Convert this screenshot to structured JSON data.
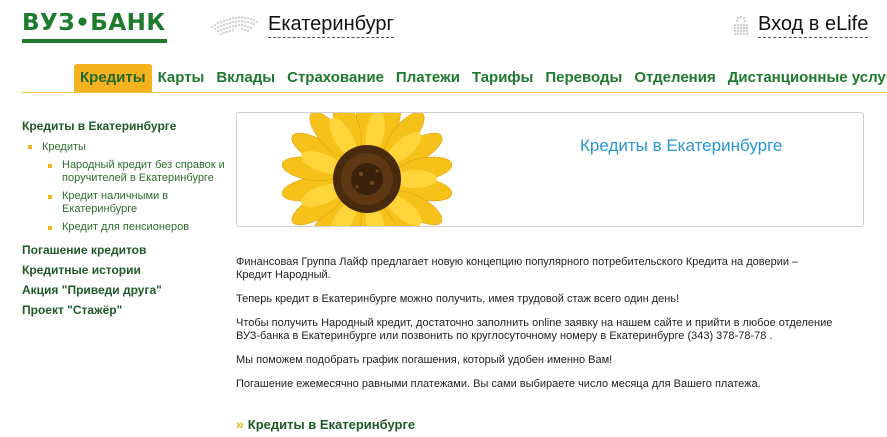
{
  "header": {
    "logo_text": "ВУЗ•БАНК",
    "city": "Екатеринбург",
    "login": "Вход в eLife"
  },
  "nav": {
    "items": [
      "Кредиты",
      "Карты",
      "Вклады",
      "Страхование",
      "Платежи",
      "Тарифы",
      "Переводы",
      "Отделения",
      "Дистанционные услуги"
    ],
    "active": "Кредиты"
  },
  "sidebar": {
    "heading": "Кредиты в Екатеринбурге",
    "level1": "Кредиты",
    "level2": [
      "Народный кредит без справок и поручителей в Екатеринбурге",
      "Кредит наличными в Екатеринбурге",
      "Кредит для пенсионеров"
    ],
    "links": [
      "Погашение кредитов",
      "Кредитные истории",
      "Акция \"Приведи друга\"",
      "Проект \"Стажёр\""
    ]
  },
  "banner": {
    "title": "Кредиты в Екатеринбурге"
  },
  "content": {
    "paragraphs": [
      "Финансовая Группа Лайф предлагает новую концепцию популярного потребительского Кредита на доверии – Кредит Народный.",
      "Теперь кредит в Екатеринбурге можно получить, имея трудовой стаж всего один день!",
      "Чтобы получить Народный кредит, достаточно заполнить online заявку на нашем сайте и прийти в любое отделение ВУЗ-банка в Екатеринбурге или позвонить по круглосуточному номеру в Екатеринбурге (343) 378-78-78 .",
      "Мы поможем подобрать график погашения, который удобен именно Вам!",
      "Погашение ежемесячно равными платежами. Вы сами выбираете число месяца для Вашего платежа."
    ],
    "more_link": "Кредиты в Екатеринбурге"
  },
  "colors": {
    "brand_green": "#1e7a2e",
    "accent_orange": "#f5b11e",
    "banner_blue": "#2a96d0"
  },
  "icons": [
    "russia-map-icon",
    "lock-icon",
    "sunflower-image",
    "double-chevron-icon"
  ]
}
